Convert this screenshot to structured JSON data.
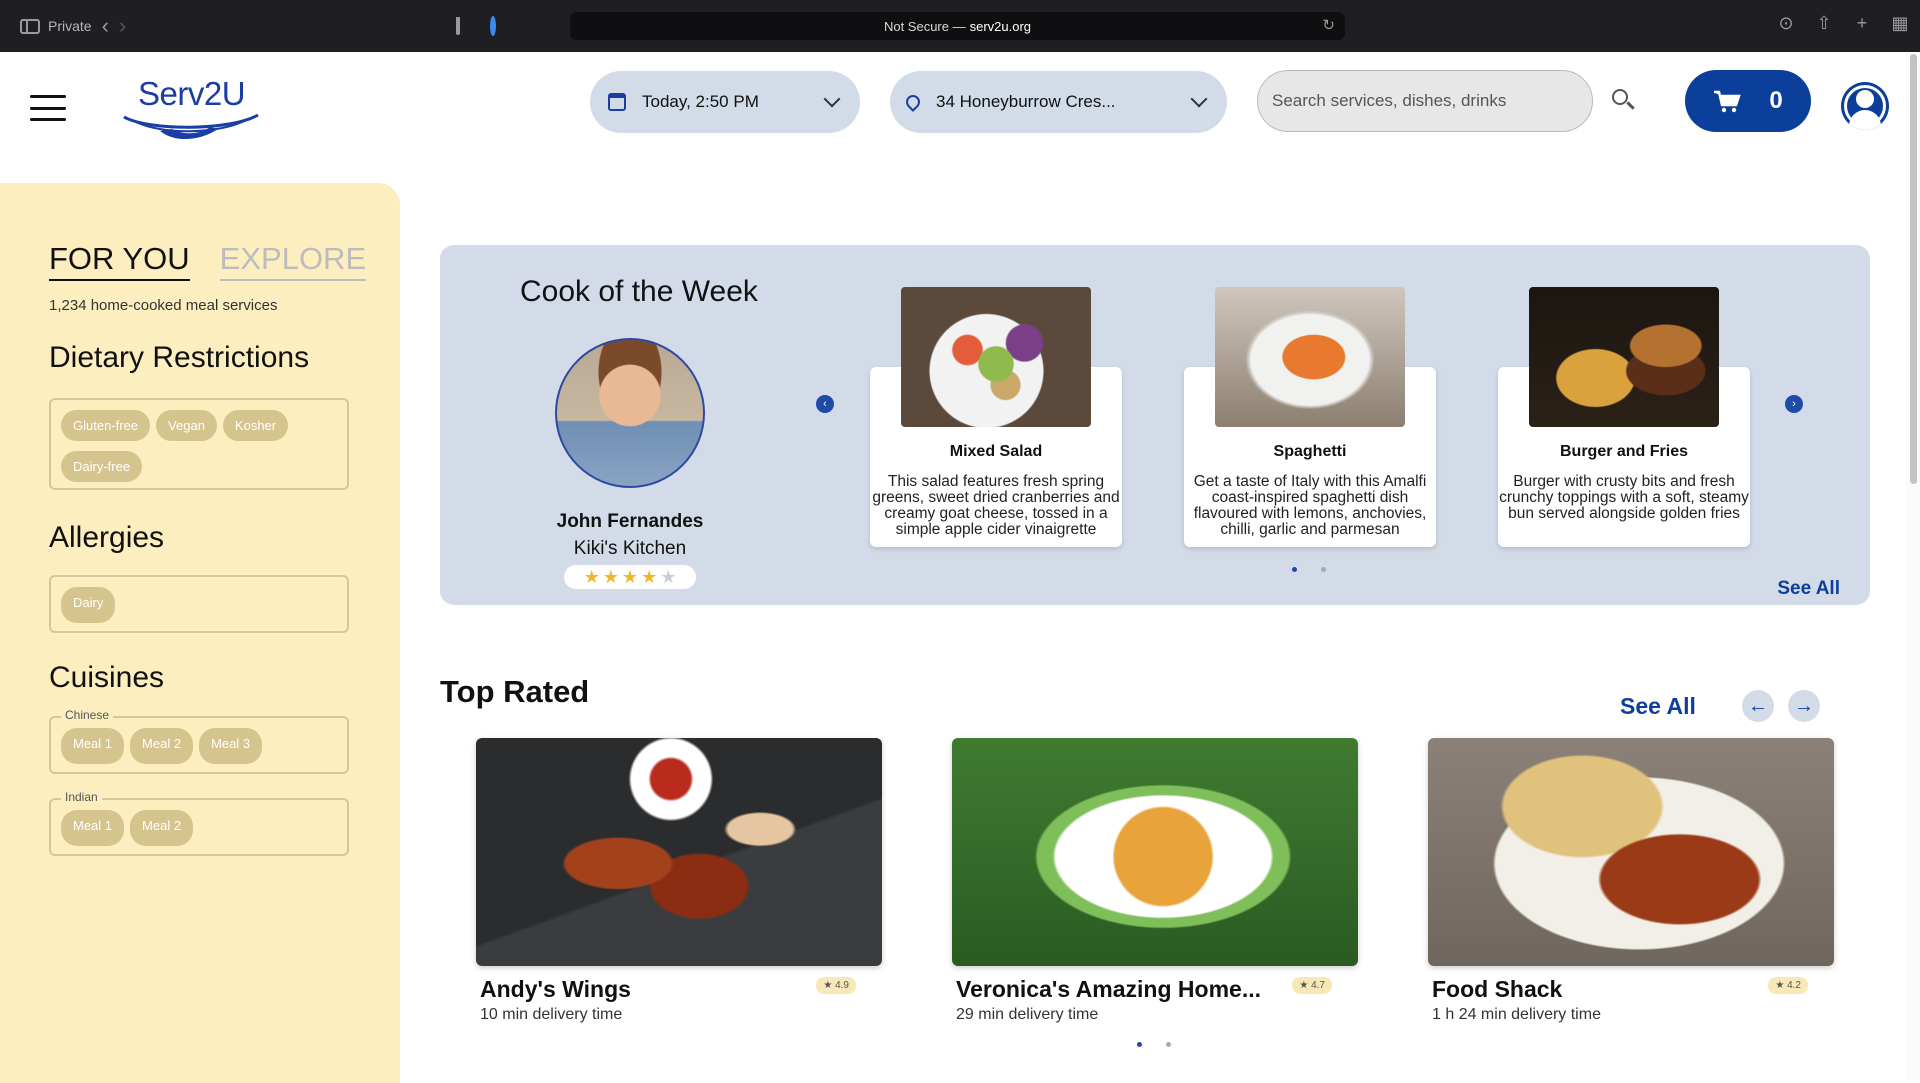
{
  "browser": {
    "private_label": "Private",
    "url_prefix": "Not Secure —",
    "url_host": "serv2u.org"
  },
  "header": {
    "logo_text": "Serv2U",
    "date_label": "Today, 2:50 PM",
    "address_label": "34 Honeyburrow Cres...",
    "search_placeholder": "Search services, dishes, drinks",
    "cart_count": "0",
    "brand_color": "#0c3f9c"
  },
  "sidebar": {
    "tabs": [
      "FOR YOU",
      "EXPLORE"
    ],
    "active_tab": "FOR YOU",
    "count_text": "1,234 home-cooked meal services",
    "dietary_heading": "Dietary Restrictions",
    "dietary": [
      "Gluten-free",
      "Vegan",
      "Kosher",
      "Dairy-free"
    ],
    "allergies_heading": "Allergies",
    "allergies": [
      "Dairy"
    ],
    "cuisines_heading": "Cuisines",
    "cuisines": [
      {
        "name": "Chinese",
        "meals": [
          "Meal 1",
          "Meal 2",
          "Meal 3"
        ]
      },
      {
        "name": "Indian",
        "meals": [
          "Meal 1",
          "Meal 2"
        ]
      }
    ]
  },
  "cook_of_week": {
    "title": "Cook of the Week",
    "cook_name": "John Fernandes",
    "kitchen": "Kiki's Kitchen",
    "rating_stars": 4,
    "rating_max": 5,
    "dishes": [
      {
        "title": "Mixed Salad",
        "description": "This salad features fresh spring greens, sweet dried cranberries and creamy goat cheese, tossed in a simple apple cider vinaigrette"
      },
      {
        "title": "Spaghetti",
        "description": "Get a taste of Italy with this Amalfi coast-inspired spaghetti dish flavoured with lemons, anchovies, chilli, garlic and parmesan"
      },
      {
        "title": "Burger and Fries",
        "description": "Burger with crusty bits and fresh crunchy toppings with a soft, steamy bun served alongside golden fries"
      }
    ],
    "see_all": "See All"
  },
  "top_rated": {
    "title": "Top Rated",
    "see_all": "See All",
    "restaurants": [
      {
        "name": "Andy's Wings",
        "rating": "★ 4.9",
        "delivery": "10 min delivery time"
      },
      {
        "name": "Veronica's Amazing Home...",
        "rating": "★ 4.7",
        "delivery": "29 min delivery time"
      },
      {
        "name": "Food Shack",
        "rating": "★ 4.2",
        "delivery": "1 h 24 min delivery time"
      }
    ]
  }
}
